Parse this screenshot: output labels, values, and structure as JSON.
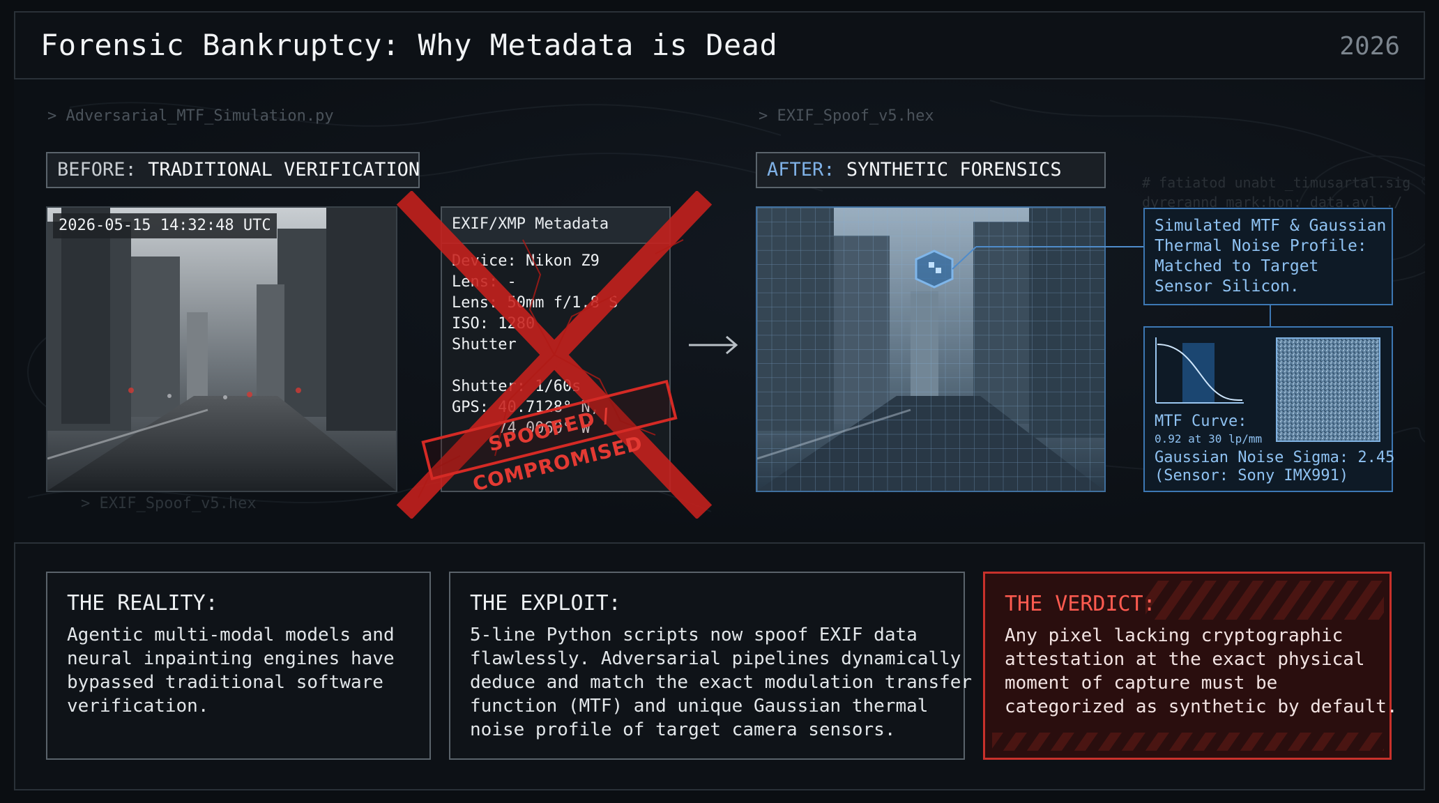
{
  "header": {
    "title": "Forensic Bankruptcy: Why Metadata is Dead",
    "year": "2026"
  },
  "commands": {
    "left": "> Adversarial_MTF_Simulation.py",
    "right": "> EXIF_Spoof_v5.hex",
    "ghost": "> EXIF_Spoof_v5.hex",
    "ghost_code_1": "# fatiatod unabt _timusartal.sig",
    "ghost_code_2": "dyrerannd mark:hon: data.avl ./"
  },
  "before": {
    "label_key": "BEFORE:",
    "label_value": "TRADITIONAL VERIFICATION",
    "timestamp": "2026-05-15 14:32:48 UTC",
    "metadata": {
      "header": "EXIF/XMP Metadata",
      "lines": [
        "Device: Nikon Z9",
        "Lens: -",
        "Lens: 50mm f/1.8 S",
        "ISO: 1280",
        "Shutter",
        "Shutter: 1/60s",
        "GPS: 40.7128° N,",
        "     74.0060° W"
      ]
    },
    "stamp": "SPOOFED / COMPROMISED"
  },
  "after": {
    "label_key": "AFTER:",
    "label_value": "SYNTHETIC FORENSICS",
    "callout_text": "Simulated MTF & Gaussian\nThermal Noise Profile:\nMatched to Target\nSensor Silicon.",
    "mtf_label": "MTF Curve:",
    "mtf_value": "0.92 at 30 lp/mm",
    "noise_line": "Gaussian Noise Sigma: 2.45",
    "sensor_line": "(Sensor: Sony IMX991)"
  },
  "cards": [
    {
      "heading": "THE REALITY:",
      "body": "Agentic multi-modal models and\nneural inpainting engines have\nbypassed traditional software\nverification."
    },
    {
      "heading": "THE EXPLOIT:",
      "body": "5-line Python scripts now spoof EXIF data\nflawlessly. Adversarial pipelines dynamically\ndeduce and match the exact modulation transfer\nfunction (MTF) and unique Gaussian thermal\nnoise profile of target camera sensors."
    },
    {
      "heading": "THE VERDICT:",
      "body": "Any pixel lacking cryptographic\nattestation at the exact physical\nmoment of capture must be\ncategorized as synthetic by default."
    }
  ],
  "colors": {
    "accent_red": "#d52a25",
    "accent_blue": "#3d78b4",
    "background": "#0b0e12"
  }
}
